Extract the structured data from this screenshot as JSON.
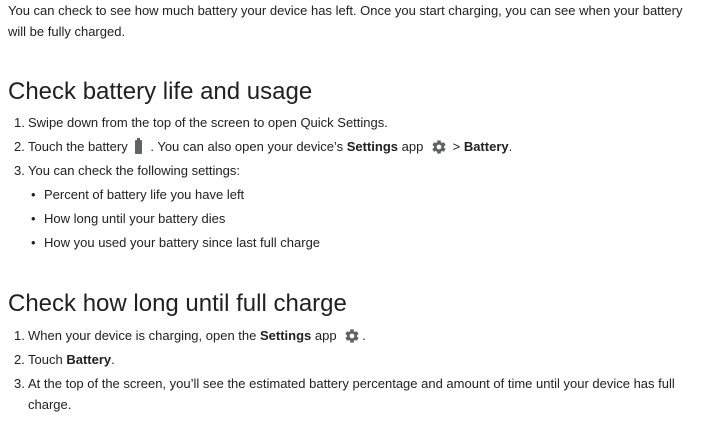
{
  "intro": "You can check to see how much battery your device has left. Once you start charging, you can see when your battery will be fully charged.",
  "section1": {
    "title": "Check battery life and usage",
    "steps": [
      {
        "num": "1.",
        "text": "Swipe down from the top of the screen to open Quick Settings."
      },
      {
        "num": "2.",
        "pre": "Touch the battery",
        "mid": ". You can also open your device’s",
        "settings": "Settings",
        "app": "app",
        "sep": ">",
        "battery": "Battery",
        "end": "."
      },
      {
        "num": "3.",
        "text": "You can check the following settings:"
      }
    ],
    "bullets": [
      "Percent of battery life you have left",
      "How long until your battery dies",
      "How you used your battery since last full charge"
    ]
  },
  "section2": {
    "title": "Check how long until full charge",
    "steps": [
      {
        "num": "1.",
        "pre": "When your device is charging, open the",
        "settings": "Settings",
        "app": "app",
        "end": "."
      },
      {
        "num": "2.",
        "pre": "Touch",
        "battery": "Battery",
        "end": "."
      },
      {
        "num": "3.",
        "text": "At the top of the screen, you’ll see the estimated battery percentage and amount of time until your device has full charge."
      }
    ]
  },
  "bullet_char": "•",
  "icons": {
    "battery": "battery-icon",
    "settings": "gear-icon"
  },
  "colors": {
    "text": "#202124",
    "icon": "#5f6368"
  }
}
